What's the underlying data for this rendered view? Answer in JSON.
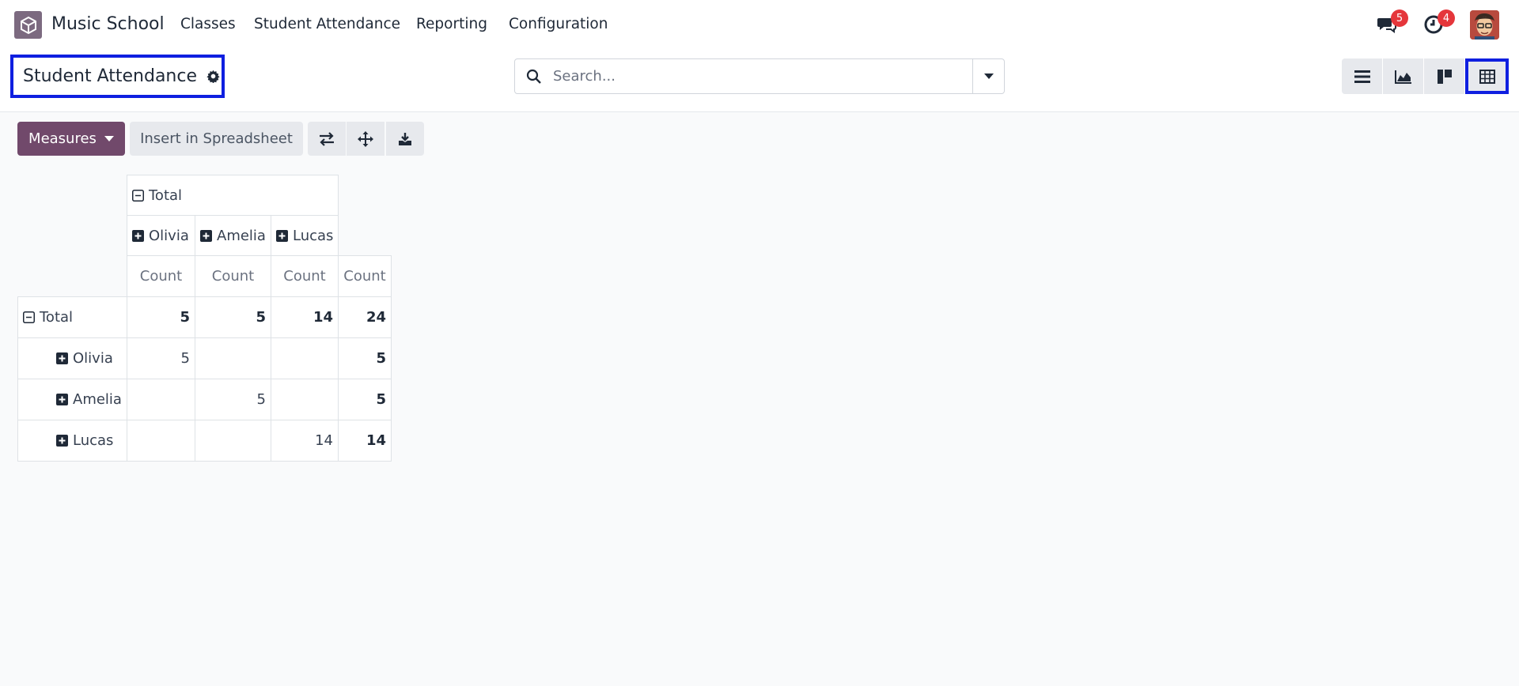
{
  "app": {
    "name": "Music School",
    "logo_icon": "app-cube-icon"
  },
  "menu": [
    "Classes",
    "Student Attendance",
    "Reporting",
    "Configuration"
  ],
  "systray": {
    "messages_count": "5",
    "activities_count": "4"
  },
  "breadcrumb": {
    "title": "Student Attendance"
  },
  "search": {
    "placeholder": "Search..."
  },
  "toolbar": {
    "measures_label": "Measures",
    "spreadsheet_label": "Insert in Spreadsheet"
  },
  "pivot": {
    "col_header_total": "Total",
    "col_groups": [
      "Olivia",
      "Amelia",
      "Lucas"
    ],
    "measure": "Count",
    "row_header_total": "Total",
    "total_row": [
      "5",
      "5",
      "14",
      "24"
    ],
    "rows": [
      {
        "label": "Olivia",
        "values": [
          "5",
          "",
          "",
          "5"
        ]
      },
      {
        "label": "Amelia",
        "values": [
          "",
          "5",
          "",
          "5"
        ]
      },
      {
        "label": "Lucas",
        "values": [
          "",
          "",
          "14",
          "14"
        ]
      }
    ]
  },
  "colors": {
    "brand": "#71496b",
    "highlight": "#0f1fe0",
    "badge": "#e5363b"
  }
}
